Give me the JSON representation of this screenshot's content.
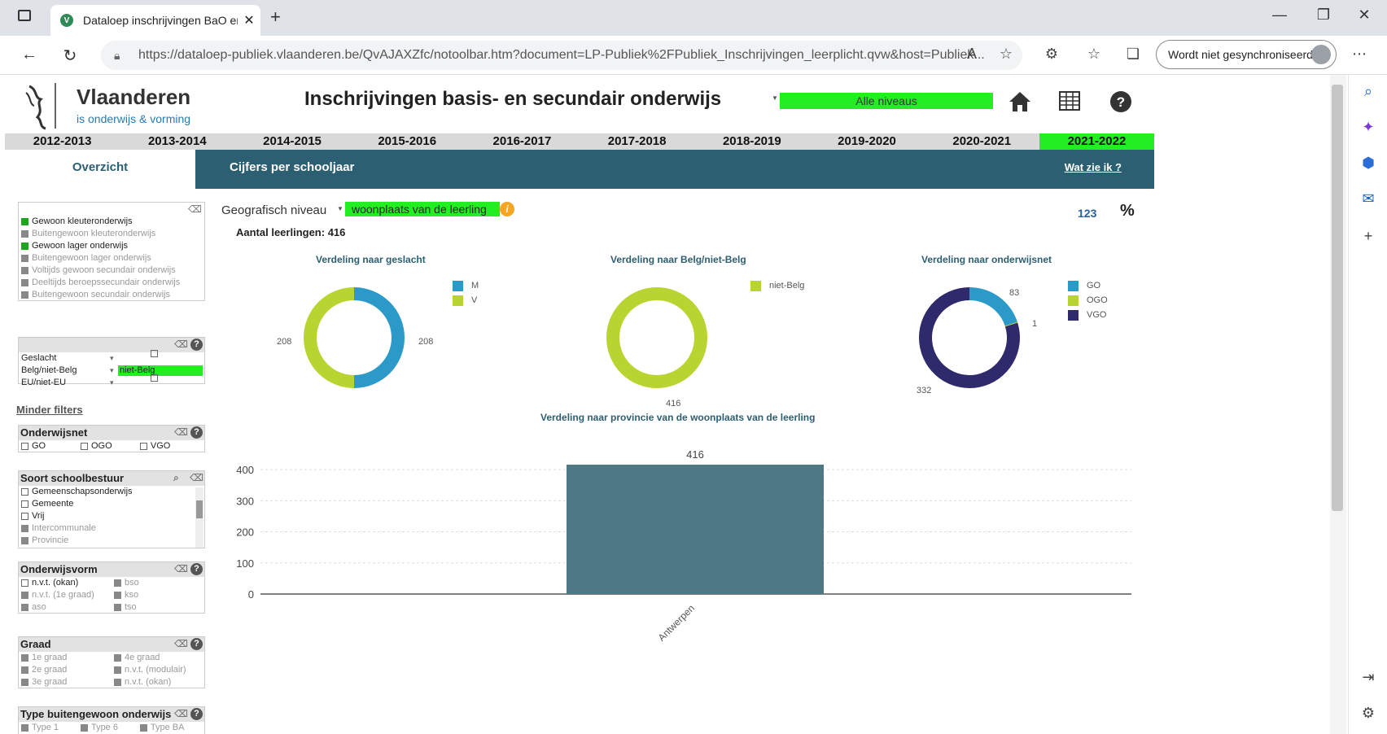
{
  "browser": {
    "tab_title": "Dataloep inschrijvingen BaO en S",
    "url": "https://dataloep-publiek.vlaanderen.be/QvAJAXZfc/notoolbar.htm?document=LP-Publiek%2FPubliek_Inschrijvingen_leerplicht.qvw&host=Publiek...",
    "sync_label": "Wordt niet gesynchroniseerd"
  },
  "header": {
    "logo_name": "Vlaanderen",
    "logo_sub": "is onderwijs & vorming",
    "title": "Inschrijvingen basis- en secundair onderwijs",
    "niveau": "Alle niveaus"
  },
  "years": [
    "2012-2013",
    "2013-2014",
    "2014-2015",
    "2015-2016",
    "2016-2017",
    "2017-2018",
    "2018-2019",
    "2019-2020",
    "2020-2021",
    "2021-2022"
  ],
  "active_year": "2021-2022",
  "tabs": {
    "overzicht": "Overzicht",
    "cijfers": "Cijfers per schooljaar",
    "watzie": "Wat zie ik ?"
  },
  "filters": {
    "levels": [
      {
        "label": "Gewoon kleuteronderwijs",
        "state": "sel"
      },
      {
        "label": "Buitengewoon kleuteronderwijs",
        "state": "grey"
      },
      {
        "label": "Gewoon lager onderwijs",
        "state": "sel"
      },
      {
        "label": "Buitengewoon lager onderwijs",
        "state": "grey"
      },
      {
        "label": "Voltijds gewoon secundair onderwijs",
        "state": "grey"
      },
      {
        "label": "Deeltijds beroepssecundair onderwijs",
        "state": "grey"
      },
      {
        "label": "Buitengewoon secundair onderwijs",
        "state": "grey"
      }
    ],
    "attrs": [
      {
        "label": "Geslacht",
        "value": ""
      },
      {
        "label": "Belg/niet-Belg",
        "value": "niet-Belg"
      },
      {
        "label": "EU/niet-EU",
        "value": ""
      }
    ],
    "minder": "Minder filters",
    "onderwijsnet": {
      "title": "Onderwijsnet",
      "items": [
        "GO",
        "OGO",
        "VGO"
      ]
    },
    "schoolbestuur": {
      "title": "Soort schoolbestuur",
      "items": [
        {
          "label": "Gemeenschapsonderwijs",
          "state": "empty"
        },
        {
          "label": "Gemeente",
          "state": "empty"
        },
        {
          "label": "Vrij",
          "state": "empty"
        },
        {
          "label": "Intercommunale",
          "state": "grey"
        },
        {
          "label": "Provincie",
          "state": "grey"
        }
      ]
    },
    "onderwijsvorm": {
      "title": "Onderwijsvorm",
      "items": [
        {
          "label": "n.v.t. (okan)",
          "state": "empty"
        },
        {
          "label": "bso",
          "state": "grey"
        },
        {
          "label": "n.v.t. (1e graad)",
          "state": "grey"
        },
        {
          "label": "kso",
          "state": "grey"
        },
        {
          "label": "aso",
          "state": "grey"
        },
        {
          "label": "tso",
          "state": "grey"
        }
      ]
    },
    "graad": {
      "title": "Graad",
      "items": [
        {
          "label": "1e graad",
          "state": "grey"
        },
        {
          "label": "4e graad",
          "state": "grey"
        },
        {
          "label": "2e graad",
          "state": "grey"
        },
        {
          "label": "n.v.t. (modulair)",
          "state": "grey"
        },
        {
          "label": "3e graad",
          "state": "grey"
        },
        {
          "label": "n.v.t. (okan)",
          "state": "grey"
        }
      ]
    },
    "buitengewoon": {
      "title": "Type buitengewoon onderwijs",
      "items": [
        "Type 1",
        "Type 6",
        "Type BA"
      ]
    }
  },
  "main": {
    "geo_label": "Geografisch niveau",
    "geo_value": "woonplaats van de leerling",
    "aantal": "Aantal leerlingen: 416",
    "btn_123": "123",
    "btn_pct": "%"
  },
  "colors": {
    "go": "#2b9ac9",
    "ogo": "#b8d430",
    "vgo": "#2f2a6b",
    "bar": "#4e7883",
    "green": "#22ee22",
    "navy": "#2d5f72"
  },
  "chart_data": [
    {
      "type": "pie",
      "title": "Verdeling naar geslacht",
      "categories": [
        "M",
        "V"
      ],
      "values": [
        208,
        208
      ],
      "colors": [
        "#2b9ac9",
        "#b8d430"
      ]
    },
    {
      "type": "pie",
      "title": "Verdeling naar Belg/niet-Belg",
      "categories": [
        "niet-Belg"
      ],
      "values": [
        416
      ],
      "colors": [
        "#b8d430"
      ]
    },
    {
      "type": "pie",
      "title": "Verdeling naar onderwijsnet",
      "categories": [
        "GO",
        "OGO",
        "VGO"
      ],
      "values": [
        83,
        1,
        332
      ],
      "colors": [
        "#2b9ac9",
        "#b8d430",
        "#2f2a6b"
      ]
    },
    {
      "type": "bar",
      "title": "Verdeling naar provincie van de woonplaats van de leerling",
      "categories": [
        "Antwerpen"
      ],
      "values": [
        416
      ],
      "ylim": [
        0,
        400
      ],
      "yticks": [
        0,
        100,
        200,
        300,
        400
      ],
      "grid": true
    }
  ]
}
